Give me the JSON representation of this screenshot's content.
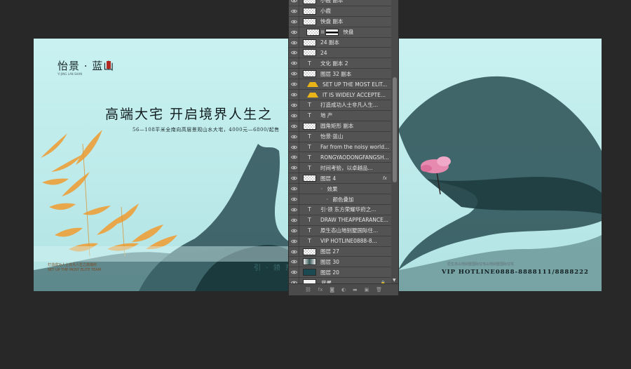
{
  "document": {
    "logo_title": "怡景 · 蓝山",
    "logo_subtitle": "YI JING LAN SHAN",
    "headline": "高端大宅 开启境界人生之",
    "subline": "56—108平米全南向高层景观山水大宅，4000元—6800/起售",
    "bottom_left_line1": "打造成功人士非凡人生之高端府",
    "bottom_left_line2": "SET UP THE MOST ELITE TEAM",
    "bottom_mid": "引 · 领 东方",
    "bottom_small": "原生态山地别墅国际住宅山地别墅国际住宅",
    "hotline": "VIP HOTLINE0888-8888111/8888222",
    "colors": {
      "canvas_bg": "#c6efef",
      "ink": "#1d3a3e",
      "bamboo": "#e7a74a",
      "blossom": "#e879a8"
    }
  },
  "layers_panel": {
    "rows": [
      {
        "kind": "raster",
        "name": "小鹿 副本",
        "visible": true
      },
      {
        "kind": "raster",
        "name": "小鹿",
        "visible": true
      },
      {
        "kind": "raster",
        "name": "怏盘 副本",
        "visible": true
      },
      {
        "kind": "masked",
        "name": "怏盘",
        "visible": true
      },
      {
        "kind": "raster",
        "name": "24 副本",
        "visible": true
      },
      {
        "kind": "raster",
        "name": "24",
        "visible": true
      },
      {
        "kind": "text",
        "name": "文化 副本 2",
        "visible": true
      },
      {
        "kind": "raster",
        "name": "图层 32 副本",
        "visible": true
      },
      {
        "kind": "warn",
        "name": "SET UP THE MOST ELIT...",
        "visible": true
      },
      {
        "kind": "warn",
        "name": "IT IS WIDELY ACCEPTE...",
        "visible": true
      },
      {
        "kind": "text",
        "name": "打造成功人士非凡人生...",
        "visible": true
      },
      {
        "kind": "text",
        "name": "地 产",
        "visible": true
      },
      {
        "kind": "raster",
        "name": "圆角矩形 副本",
        "visible": true
      },
      {
        "kind": "text",
        "name": "怡景·蓝山",
        "visible": true
      },
      {
        "kind": "text",
        "name": "Far from the noisy world...",
        "visible": true
      },
      {
        "kind": "text",
        "name": "RONGYAODONGFANGSH...",
        "visible": true
      },
      {
        "kind": "text",
        "name": "时间考验，以卓越品...",
        "visible": true
      },
      {
        "kind": "raster-fx",
        "name": "图层 4",
        "visible": true,
        "fx": "fx"
      },
      {
        "kind": "effects",
        "name": "效果",
        "visible": true
      },
      {
        "kind": "effect",
        "name": "颜色叠加",
        "visible": true
      },
      {
        "kind": "text",
        "name": "引·领 东方荣耀华府之...",
        "visible": true
      },
      {
        "kind": "text",
        "name": "DRAW THEAPPEARANCE...",
        "visible": true
      },
      {
        "kind": "text",
        "name": "原生态山地别墅国际住...",
        "visible": true
      },
      {
        "kind": "text",
        "name": "VIP HOTLINE0888-8...",
        "visible": true
      },
      {
        "kind": "raster",
        "name": "图层 27",
        "visible": true
      },
      {
        "kind": "scene",
        "name": "图层 30",
        "visible": true
      },
      {
        "kind": "dark",
        "name": "图层 20",
        "visible": true
      },
      {
        "kind": "background",
        "name": "背景",
        "visible": true
      }
    ],
    "bottom_icons": [
      "link-icon",
      "fx-icon",
      "mask-icon",
      "adjustment-icon",
      "group-icon",
      "new-layer-icon",
      "trash-icon"
    ]
  }
}
